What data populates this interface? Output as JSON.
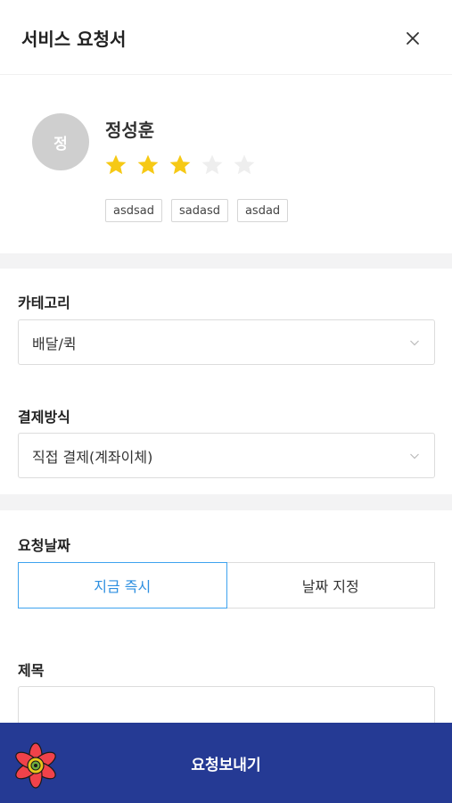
{
  "header": {
    "title": "서비스 요청서",
    "close_icon": "close-icon"
  },
  "profile": {
    "avatar_initial": "정",
    "name": "정성훈",
    "rating": 3,
    "max_rating": 5,
    "tags": [
      "asdsad",
      "sadasd",
      "asdad"
    ]
  },
  "form": {
    "category": {
      "label": "카테고리",
      "value": "배달/퀵"
    },
    "payment": {
      "label": "결제방식",
      "value": "직접 결제(계좌이체)"
    },
    "date": {
      "label": "요청날짜",
      "options": [
        "지금 즉시",
        "날짜 지정"
      ],
      "selected": "지금 즉시"
    },
    "title": {
      "label": "제목",
      "value": ""
    }
  },
  "submit": {
    "label": "요청보내기"
  },
  "colors": {
    "accent": "#3ea3ef",
    "star_on": "#f6c915",
    "star_off": "#eeeeee",
    "submit_bg": "#253a94"
  }
}
